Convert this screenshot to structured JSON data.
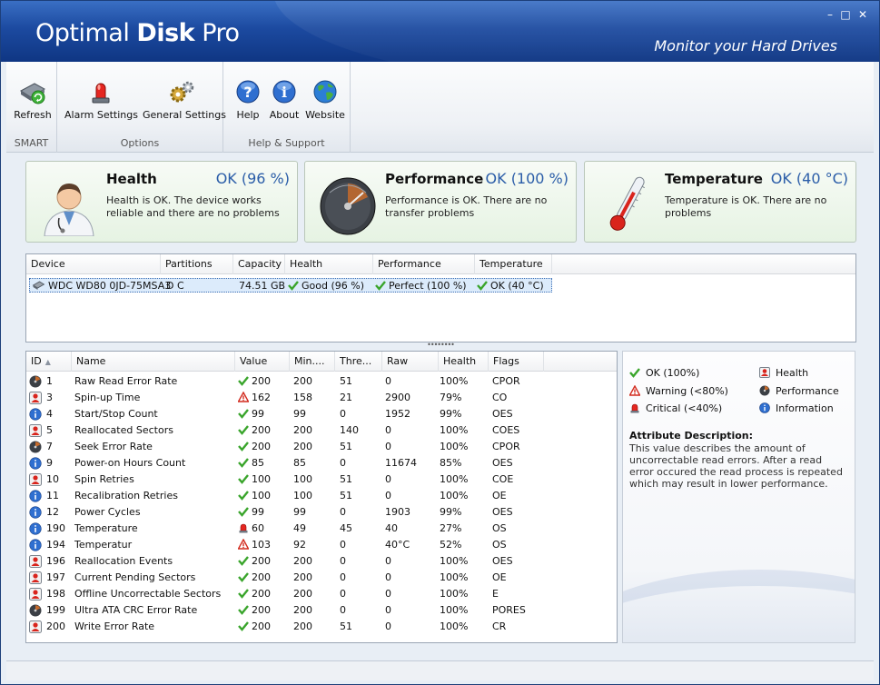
{
  "app": {
    "title_light": "Optimal ",
    "title_bold": "Disk",
    "title_tail": " Pro",
    "tagline": "Monitor your Hard Drives",
    "window_buttons": [
      "–",
      "□",
      "✕"
    ]
  },
  "toolbar": {
    "groups": [
      {
        "label": "SMART",
        "buttons": [
          {
            "label": "Refresh",
            "icon": "disk-refresh-icon"
          }
        ]
      },
      {
        "label": "Options",
        "buttons": [
          {
            "label": "Alarm Settings",
            "icon": "alarm-siren-icon"
          },
          {
            "label": "General Settings",
            "icon": "gears-icon"
          }
        ]
      },
      {
        "label": "Help & Support",
        "buttons": [
          {
            "label": "Help",
            "icon": "help-icon"
          },
          {
            "label": "About",
            "icon": "info-icon"
          },
          {
            "label": "Website",
            "icon": "globe-icon"
          }
        ]
      }
    ]
  },
  "panels": {
    "health": {
      "title": "Health",
      "value": "OK (96 %)",
      "desc": "Health is OK. The device works reliable and there are no problems",
      "icon": "doctor-icon"
    },
    "performance": {
      "title": "Performance",
      "value": "OK (100 %)",
      "desc": "Performance is OK. There are no transfer problems",
      "icon": "speedometer-icon"
    },
    "temperature": {
      "title": "Temperature",
      "value": "OK (40 °C)",
      "desc": "Temperature is OK. There are no problems",
      "icon": "thermometer-icon"
    }
  },
  "devices": {
    "columns": [
      "Device",
      "Partitions",
      "Capacity",
      "Health",
      "Performance",
      "Temperature"
    ],
    "rows": [
      {
        "device": "WDC WD80 0JD-75MSA3",
        "partitions": "D C",
        "capacity": "74.51 GB",
        "health": "Good (96 %)",
        "performance": "Perfect (100 %)",
        "temperature": "OK (40 °C)"
      }
    ]
  },
  "splitter": "••••••••",
  "attributes": {
    "columns": [
      "ID",
      "Name",
      "Value",
      "Min....",
      "Thre...",
      "Raw",
      "Health",
      "Flags"
    ],
    "rows": [
      {
        "type": "perf",
        "id": "1",
        "name": "Raw Read Error Rate",
        "status": "ok",
        "value": "200",
        "min": "200",
        "thr": "51",
        "raw": "0",
        "health": "100%",
        "flags": "CPOR"
      },
      {
        "type": "health",
        "id": "3",
        "name": "Spin-up Time",
        "status": "warn",
        "value": "162",
        "min": "158",
        "thr": "21",
        "raw": "2900",
        "health": "79%",
        "flags": "CO"
      },
      {
        "type": "info",
        "id": "4",
        "name": "Start/Stop Count",
        "status": "ok",
        "value": "99",
        "min": "99",
        "thr": "0",
        "raw": "1952",
        "health": "99%",
        "flags": "OES"
      },
      {
        "type": "health",
        "id": "5",
        "name": "Reallocated Sectors",
        "status": "ok",
        "value": "200",
        "min": "200",
        "thr": "140",
        "raw": "0",
        "health": "100%",
        "flags": "COES"
      },
      {
        "type": "perf",
        "id": "7",
        "name": "Seek Error Rate",
        "status": "ok",
        "value": "200",
        "min": "200",
        "thr": "51",
        "raw": "0",
        "health": "100%",
        "flags": "CPOR"
      },
      {
        "type": "info",
        "id": "9",
        "name": "Power-on Hours Count",
        "status": "ok",
        "value": "85",
        "min": "85",
        "thr": "0",
        "raw": "11674",
        "health": "85%",
        "flags": "OES"
      },
      {
        "type": "health",
        "id": "10",
        "name": "Spin Retries",
        "status": "ok",
        "value": "100",
        "min": "100",
        "thr": "51",
        "raw": "0",
        "health": "100%",
        "flags": "COE"
      },
      {
        "type": "info",
        "id": "11",
        "name": "Recalibration Retries",
        "status": "ok",
        "value": "100",
        "min": "100",
        "thr": "51",
        "raw": "0",
        "health": "100%",
        "flags": "OE"
      },
      {
        "type": "info",
        "id": "12",
        "name": "Power Cycles",
        "status": "ok",
        "value": "99",
        "min": "99",
        "thr": "0",
        "raw": "1903",
        "health": "99%",
        "flags": "OES"
      },
      {
        "type": "info",
        "id": "190",
        "name": "Temperature",
        "status": "crit",
        "value": "60",
        "min": "49",
        "thr": "45",
        "raw": "40",
        "health": "27%",
        "flags": "OS"
      },
      {
        "type": "info",
        "id": "194",
        "name": "Temperatur",
        "status": "warn",
        "value": "103",
        "min": "92",
        "thr": "0",
        "raw": "40°C",
        "health": "52%",
        "flags": "OS"
      },
      {
        "type": "health",
        "id": "196",
        "name": "Reallocation Events",
        "status": "ok",
        "value": "200",
        "min": "200",
        "thr": "0",
        "raw": "0",
        "health": "100%",
        "flags": "OES"
      },
      {
        "type": "health",
        "id": "197",
        "name": "Current Pending Sectors",
        "status": "ok",
        "value": "200",
        "min": "200",
        "thr": "0",
        "raw": "0",
        "health": "100%",
        "flags": "OE"
      },
      {
        "type": "health",
        "id": "198",
        "name": "Offline Uncorrectable Sectors",
        "status": "ok",
        "value": "200",
        "min": "200",
        "thr": "0",
        "raw": "0",
        "health": "100%",
        "flags": "E"
      },
      {
        "type": "perf",
        "id": "199",
        "name": "Ultra ATA CRC Error Rate",
        "status": "ok",
        "value": "200",
        "min": "200",
        "thr": "0",
        "raw": "0",
        "health": "100%",
        "flags": "PORES"
      },
      {
        "type": "health",
        "id": "200",
        "name": "Write Error Rate",
        "status": "ok",
        "value": "200",
        "min": "200",
        "thr": "51",
        "raw": "0",
        "health": "100%",
        "flags": "CR"
      }
    ]
  },
  "legend": {
    "ok": "OK (100%)",
    "warning": "Warning (<80%)",
    "critical": "Critical (<40%)",
    "health": "Health",
    "performance": "Performance",
    "information": "Information",
    "desc_title": "Attribute Description:",
    "desc_text": "This value describes the amount of uncorrectable read errors. After a read error occured the read process is repeated which may result in lower performance."
  },
  "colors": {
    "title_bar": "#1c4aa0",
    "accent_value": "#2b5da8",
    "ok": "#3aa52c",
    "warn": "#d22b1e",
    "crit": "#c8161a"
  }
}
